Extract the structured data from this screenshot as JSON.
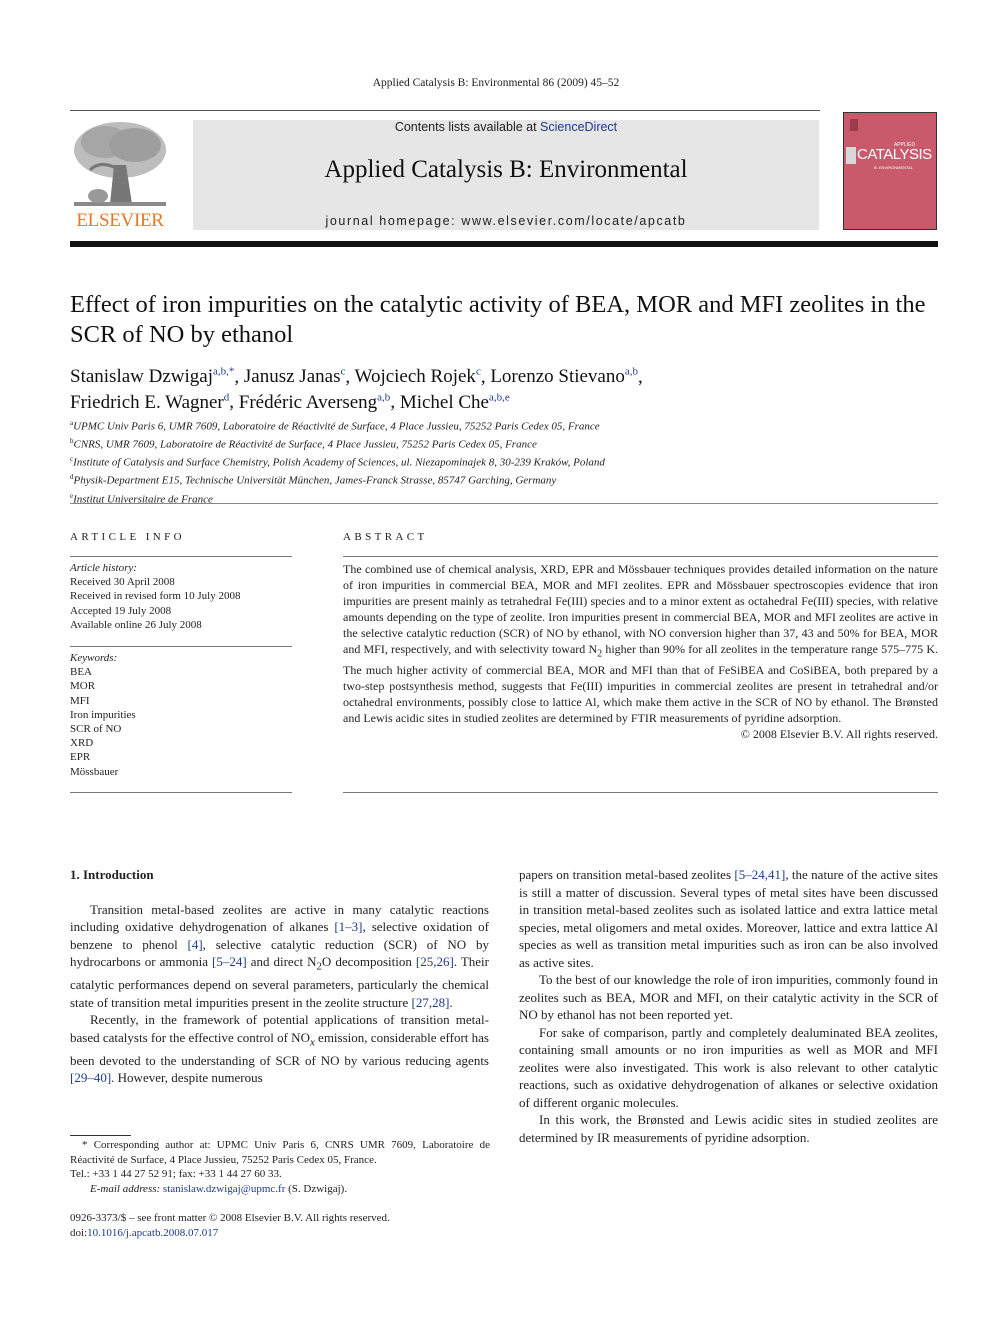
{
  "running_head": "Applied Catalysis B: Environmental 86 (2009) 45–52",
  "masthead": {
    "publisher_logo_text": "ELSEVIER",
    "contents_prefix": "Contents lists available at ",
    "contents_link": "ScienceDirect",
    "journal_title": "Applied Catalysis B: Environmental",
    "homepage": "journal homepage: www.elsevier.com/locate/apcatb",
    "cover": {
      "applied": "APPLIED",
      "title": "CATALYSIS",
      "subtitle": "B: ENVIRONMENTAL",
      "color": "#c95a6c"
    }
  },
  "article": {
    "title": "Effect of iron impurities on the catalytic activity of BEA, MOR and MFI zeolites in the SCR of NO by ethanol",
    "authors": [
      {
        "name": "Stanislaw Dzwigaj",
        "sup": "a,b,*",
        "sep": ", "
      },
      {
        "name": "Janusz Janas",
        "sup": "c",
        "sep": ", "
      },
      {
        "name": "Wojciech Rojek",
        "sup": "c",
        "sep": ", "
      },
      {
        "name": "Lorenzo Stievano",
        "sup": "a,b",
        "sep": ","
      },
      {
        "name": "Friedrich E. Wagner",
        "sup": "d",
        "sep": ", "
      },
      {
        "name": "Frédéric Averseng",
        "sup": "a,b",
        "sep": ", "
      },
      {
        "name": "Michel Che",
        "sup": "a,b,e",
        "sep": ""
      }
    ],
    "affiliations": [
      {
        "key": "a",
        "text": "UPMC Univ Paris 6, UMR 7609, Laboratoire de Réactivité de Surface, 4 Place Jussieu, 75252 Paris Cedex 05, France"
      },
      {
        "key": "b",
        "text": "CNRS, UMR 7609, Laboratoire de Réactivité de Surface, 4 Place Jussieu, 75252 Paris Cedex 05, France"
      },
      {
        "key": "c",
        "text": "Institute of Catalysis and Surface Chemistry, Polish Academy of Sciences, ul. Niezapominajek 8, 30-239 Kraków, Poland"
      },
      {
        "key": "d",
        "text": "Physik-Department E15, Technische Universität München, James-Franck Strasse, 85747 Garching, Germany"
      },
      {
        "key": "e",
        "text": "Institut Universitaire de France"
      }
    ]
  },
  "article_info": {
    "heading": "ARTICLE INFO",
    "history_label": "Article history:",
    "history": [
      "Received 30 April 2008",
      "Received in revised form 10 July 2008",
      "Accepted 19 July 2008",
      "Available online 26 July 2008"
    ],
    "keywords_label": "Keywords:",
    "keywords": [
      "BEA",
      "MOR",
      "MFI",
      "Iron impurities",
      "SCR of NO",
      "XRD",
      "EPR",
      "Mössbauer"
    ]
  },
  "abstract": {
    "heading": "ABSTRACT",
    "text_part1": "The combined use of chemical analysis, XRD, EPR and Mössbauer techniques provides detailed information on the nature of iron impurities in commercial BEA, MOR and MFI zeolites. EPR and Mössbauer spectroscopies evidence that iron impurities are present mainly as tetrahedral Fe(III) species and to a minor extent as octahedral Fe(III) species, with relative amounts depending on the type of zeolite. Iron impurities present in commercial BEA, MOR and MFI zeolites are active in the selective catalytic reduction (SCR) of NO by ethanol, with NO conversion higher than 37, 43 and 50% for BEA, MOR and MFI, respectively, and with selectivity toward N",
    "subscript": "2",
    "text_part2": " higher than 90% for all zeolites in the temperature range 575–775 K. The much higher activity of commercial BEA, MOR and MFI than that of FeSiBEA and CoSiBEA, both prepared by a two-step postsynthesis method, suggests that Fe(III) impurities in commercial zeolites are present in tetrahedral and/or octahedral environments, possibly close to lattice Al, which make them active in the SCR of NO by ethanol. The Brønsted and Lewis acidic sites in studied zeolites are determined by FTIR measurements of pyridine adsorption.",
    "copyright": "© 2008 Elsevier B.V. All rights reserved."
  },
  "intro": {
    "heading": "1.  Introduction",
    "p1": {
      "t1": "Transition metal-based zeolites are active in many catalytic reactions including oxidative dehydrogenation of alkanes ",
      "r1": "[1–3]",
      "t2": ", selective oxidation of benzene to phenol ",
      "r2": "[4]",
      "t3": ", selective catalytic reduction (SCR) of NO by hydrocarbons or ammonia ",
      "r3": "[5–24]",
      "t4": " and direct N",
      "sub": "2",
      "t5": "O decomposition ",
      "r4": "[25,26]",
      "t6": ". Their catalytic performances depend on several parameters, particularly the chemical state of transition metal impurities present in the zeolite structure ",
      "r5": "[27,28]",
      "t7": "."
    },
    "p2": {
      "t1": "Recently, in the framework of potential applications of transition metal-based catalysts for the effective control of NO",
      "sub": "x",
      "t2": " emission, considerable effort has been devoted to the understanding of SCR of NO by various reducing agents ",
      "r1": "[29–40]",
      "t3": ". However, despite numerous papers on transition metal-based zeolites ",
      "r2": "[5–24,41]",
      "t4": ", the nature of the active sites is still a matter of discussion. Several types of metal sites have been discussed in transition metal-based zeolites such as isolated lattice and extra lattice metal species, metal oligomers and metal oxides. Moreover, lattice and extra lattice Al species as well as transition metal impurities such as iron can be also involved as active sites."
    },
    "p3": "To the best of our knowledge the role of iron impurities, commonly found in zeolites such as BEA, MOR and MFI, on their catalytic activity in the SCR of NO by ethanol has not been reported yet.",
    "p4": "For sake of comparison, partly and completely dealuminated BEA zeolites, containing small amounts or no iron impurities as well as MOR and MFI zeolites were also investigated. This work is also relevant to other catalytic reactions, such as oxidative dehydrogenation of alkanes or selective oxidation of different organic molecules.",
    "p5": "In this work, the Brønsted and Lewis acidic sites in studied zeolites are determined by IR measurements of pyridine adsorption."
  },
  "footnote": {
    "star": "*",
    "corresponding": " Corresponding author at: UPMC Univ Paris 6, CNRS UMR 7609, Laboratoire de Réactivité de Surface, 4 Place Jussieu, 75252 Paris Cedex 05, France.",
    "tel": "Tel.: +33 1 44 27 52 91; fax: +33 1 44 27 60 33.",
    "email_label": "E-mail address: ",
    "email": "stanislaw.dzwigaj@upmc.fr",
    "email_suffix": " (S. Dzwigaj)."
  },
  "front_matter": {
    "issn_line": "0926-3373/$ – see front matter © 2008 Elsevier B.V. All rights reserved.",
    "doi_prefix": "doi:",
    "doi": "10.1016/j.apcatb.2008.07.017"
  }
}
